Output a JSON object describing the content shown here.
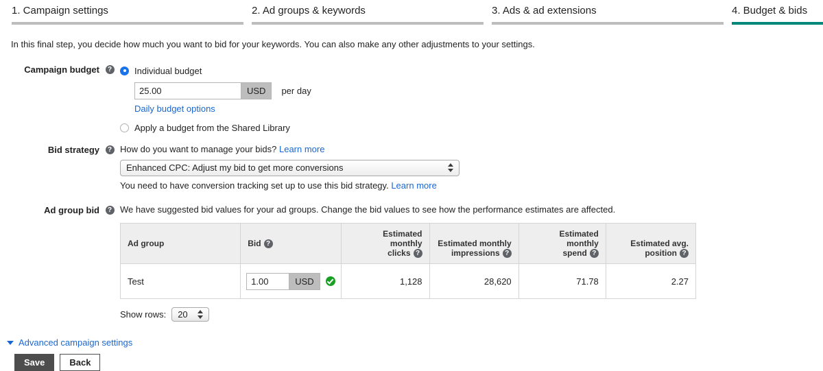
{
  "steps": [
    {
      "label": "1. Campaign settings",
      "active": false
    },
    {
      "label": "2. Ad groups & keywords",
      "active": false
    },
    {
      "label": "3. Ads & ad extensions",
      "active": false
    },
    {
      "label": "4. Budget & bids",
      "active": true
    }
  ],
  "intro": "In this final step, you decide how much you want to bid for your keywords. You can also make any other adjustments to your settings.",
  "campaign_budget": {
    "label": "Campaign budget",
    "help_glyph": "?",
    "option_individual": "Individual budget",
    "amount": "25.00",
    "currency": "USD",
    "per_day": "per day",
    "daily_options_link": "Daily budget options",
    "option_shared": "Apply a budget from the Shared Library"
  },
  "bid_strategy": {
    "label": "Bid strategy",
    "question": "How do you want to manage your bids?",
    "learn_more": "Learn more",
    "selected": "Enhanced CPC: Adjust my bid to get more conversions",
    "note": "You need to have conversion tracking set up to use this bid strategy.",
    "note_learn_more": "Learn more"
  },
  "ad_group_bid": {
    "label": "Ad group bid",
    "description": "We have suggested bid values for your ad groups. Change the bid values to see how the performance estimates are affected.",
    "columns": [
      "Ad group",
      "Bid",
      "Estimated monthly clicks",
      "Estimated monthly impressions",
      "Estimated monthly spend",
      "Estimated avg. position"
    ],
    "columns_wrapped": [
      {
        "line1": "Ad group",
        "line2": ""
      },
      {
        "line1": "Bid",
        "line2": ""
      },
      {
        "line1": "Estimated monthly",
        "line2": "clicks"
      },
      {
        "line1": "Estimated monthly",
        "line2": "impressions"
      },
      {
        "line1": "Estimated monthly",
        "line2": "spend"
      },
      {
        "line1": "Estimated avg.",
        "line2": "position"
      }
    ],
    "rows": [
      {
        "ad_group": "Test",
        "bid": "1.00",
        "currency": "USD",
        "clicks": "1,128",
        "impressions": "28,620",
        "spend": "71.78",
        "position": "2.27"
      }
    ],
    "show_rows_label": "Show rows:",
    "show_rows_value": "20"
  },
  "advanced_settings_label": "Advanced campaign settings",
  "footer": {
    "save": "Save",
    "back": "Back"
  },
  "colors": {
    "active_tab_underline": "#00887a",
    "inactive_tab_underline": "#bdbdbd",
    "link": "#1967d2",
    "radio_selected": "#1a73e8",
    "check_green": "#18a022",
    "save_button_bg": "#4d4d4d"
  }
}
